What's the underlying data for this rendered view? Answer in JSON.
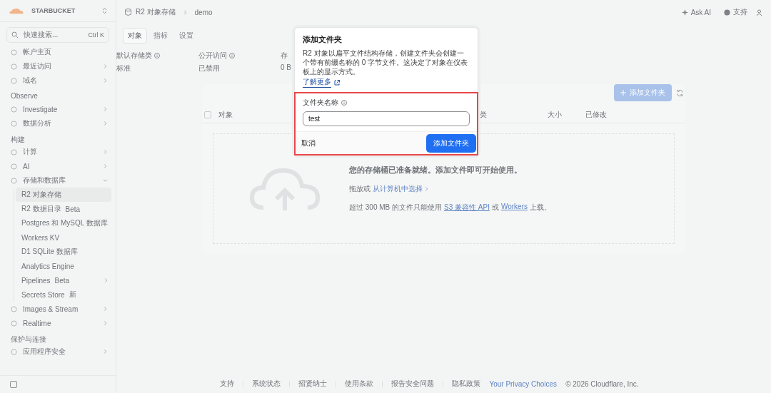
{
  "account": {
    "name": "STARBUCKET"
  },
  "search": {
    "placeholder": "快速搜索...",
    "shortcut": "Ctrl K"
  },
  "sidebar": [
    {
      "kind": "item",
      "label": "帐户主页"
    },
    {
      "kind": "item",
      "label": "最近访问",
      "expanded": false
    },
    {
      "kind": "item",
      "label": "域名",
      "expanded": false
    },
    {
      "kind": "section",
      "label": "Observe"
    },
    {
      "kind": "item",
      "label": "Investigate",
      "expanded": false
    },
    {
      "kind": "item",
      "label": "数据分析",
      "expanded": false
    },
    {
      "kind": "section",
      "label": "构建"
    },
    {
      "kind": "item",
      "label": "计算",
      "expanded": false
    },
    {
      "kind": "item",
      "label": "AI",
      "expanded": false
    },
    {
      "kind": "item",
      "label": "存储和数据库",
      "expanded": true,
      "children": [
        {
          "label": "R2 对象存储",
          "selected": true
        },
        {
          "label": "R2 数据目录",
          "badge": "Beta",
          "selected": false
        },
        {
          "label": "Postgres 和 MySQL 数据库",
          "selected": false
        },
        {
          "label": "Workers KV",
          "selected": false
        },
        {
          "label": "D1 SQLite 数据库",
          "selected": false
        },
        {
          "label": "Analytics Engine",
          "selected": false
        },
        {
          "label": "Pipelines",
          "badge": "Beta",
          "selected": false,
          "expanded": false
        },
        {
          "label": "Secrets Store",
          "badge": "新",
          "selected": false
        }
      ]
    },
    {
      "kind": "item",
      "label": "Images & Stream",
      "expanded": false
    },
    {
      "kind": "item",
      "label": "Realtime",
      "expanded": false
    },
    {
      "kind": "section",
      "label": "保护与连接"
    },
    {
      "kind": "item",
      "label": "应用程序安全",
      "expanded": false
    }
  ],
  "breadcrumb": [
    "R2 对象存储",
    "demo"
  ],
  "top_actions": [
    "Ask AI",
    "支持"
  ],
  "tabs": [
    {
      "label": "对象",
      "selected": true
    },
    {
      "label": "指标",
      "selected": false
    },
    {
      "label": "设置",
      "selected": false
    }
  ],
  "details": [
    {
      "label": "默认存储类",
      "info": true,
      "value": "标准"
    },
    {
      "label": "公开访问",
      "info": true,
      "value": "已禁用"
    },
    {
      "label": "存",
      "info": false,
      "value": "0 B"
    }
  ],
  "add_folder_button": "添加文件夹",
  "table": {
    "select_all_checked": false,
    "columns": [
      "对象",
      "类",
      "大小",
      "已修改"
    ]
  },
  "empty_state": {
    "title": "您的存储桶已准备就绪。添加文件即可开始使用。",
    "drop_prefix": "拖放或",
    "drop_link": "从计算机中选择",
    "note_parts": [
      "超过 300 MB 的文件只能使用",
      "S3 兼容性 API",
      "或",
      "Workers",
      "上载。"
    ]
  },
  "footer": {
    "links": [
      "支持",
      "系统状态",
      "招贤纳士",
      "使用条款",
      "报告安全问题",
      "隐私政策"
    ],
    "privacy": "Your Privacy Choices",
    "copyright": "© 2026 Cloudflare, Inc."
  },
  "dialog": {
    "title": "添加文件夹",
    "description": "R2 对象以扁平文件结构存储，创建文件夹会创建一个带有前缀名称的 0 字节文件。这决定了对象在仪表板上的显示方式。",
    "learn_more": "了解更多",
    "field_label": "文件夹名称",
    "field_value": "test",
    "cancel": "取消",
    "confirm": "添加文件夹"
  }
}
